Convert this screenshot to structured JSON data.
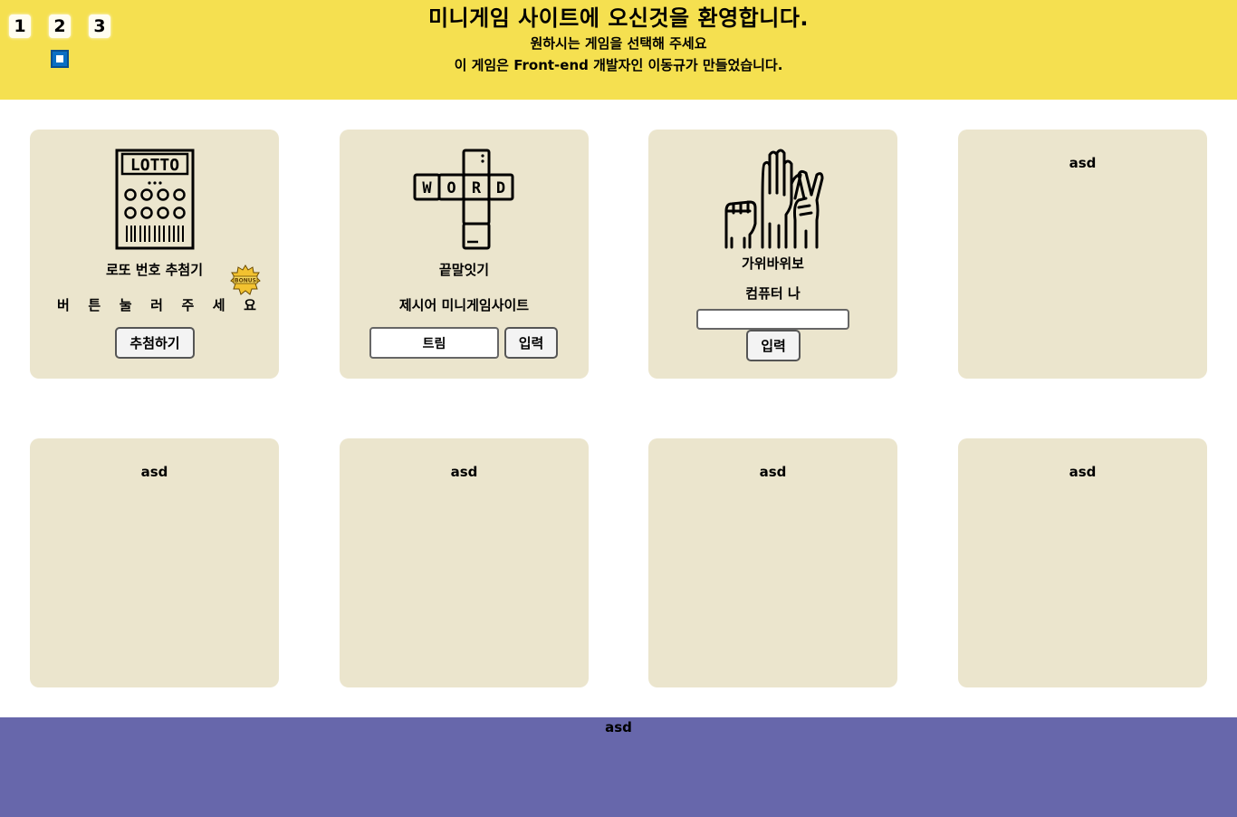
{
  "header": {
    "page_tabs": [
      "1",
      "2",
      "3"
    ],
    "title": "미니게임 사이트에 오신것을 환영합니다.",
    "subtitle": "원하시는 게임을 선택해 주세요",
    "subtitle2": "이 게임은 Front-end 개발자인 이동규가 만들었습니다."
  },
  "lotto": {
    "icon_text": "LOTTO",
    "label": "로또 번호 추첨기",
    "bonus_text": "BONUS",
    "instruction_chars": [
      "버",
      "튼",
      "눌",
      "러",
      "주",
      "세",
      "요"
    ],
    "button_label": "추첨하기"
  },
  "word": {
    "icon_letters": [
      "W",
      "O",
      "R",
      "D"
    ],
    "label": "끝말잇기",
    "prompt": "제시어 미니게임사이트",
    "input_value": "트림",
    "button_label": "입력"
  },
  "rps": {
    "label": "가위바위보",
    "result": "컴퓨터 나",
    "input_value": "",
    "button_label": "입력"
  },
  "placeholder_cards": [
    "asd",
    "asd",
    "asd",
    "asd",
    "asd"
  ],
  "footer": {
    "text": "asd"
  },
  "colors": {
    "header_bg": "#f5e050",
    "card_bg": "#ebe5cd",
    "footer_bg": "#6767ab",
    "indicator": "#0a6fc4"
  }
}
